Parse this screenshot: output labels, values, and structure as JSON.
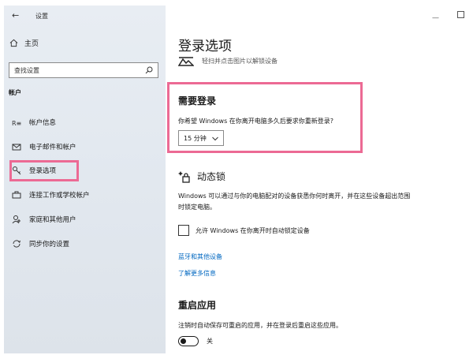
{
  "window": {
    "back_glyph": "←",
    "title": "设置",
    "minimize_glyph": "—"
  },
  "sidebar": {
    "home_label": "主页",
    "search_placeholder": "查找设置",
    "section_heading": "帐户",
    "items": [
      {
        "label": "帐户信息",
        "icon": "account-info-icon"
      },
      {
        "label": "电子邮件和帐户",
        "icon": "mail-icon"
      },
      {
        "label": "登录选项",
        "icon": "key-icon",
        "selected": true
      },
      {
        "label": "连接工作或学校帐户",
        "icon": "briefcase-icon"
      },
      {
        "label": "家庭和其他用户",
        "icon": "person-add-icon"
      },
      {
        "label": "同步你的设置",
        "icon": "sync-icon"
      }
    ]
  },
  "main": {
    "page_title": "登录选项",
    "cut_hint": "轻扫并点击图片以解锁设备",
    "require_signin": {
      "title": "需要登录",
      "question": "你希望 Windows 在你离开电脑多久后要求你重新登录?",
      "selected_value": "15 分钟"
    },
    "dynamic_lock": {
      "title": "动态锁",
      "description": "Windows 可以通过与你的电脑配对的设备获悉你何时离开，并在这些设备超出范围时锁定电脑。",
      "checkbox_label": "允许 Windows 在你离开时自动锁定设备",
      "checked": false
    },
    "links": {
      "bluetooth": "蓝牙和其他设备",
      "learn_more": "了解更多信息"
    },
    "restart_apps": {
      "title": "重启应用",
      "description": "注销时自动保存可重启的应用，并在登录后重启这些应用。",
      "toggle_label": "关",
      "toggle_on": false
    }
  },
  "colors": {
    "highlight": "#ec6a94",
    "link": "#0067c0"
  }
}
